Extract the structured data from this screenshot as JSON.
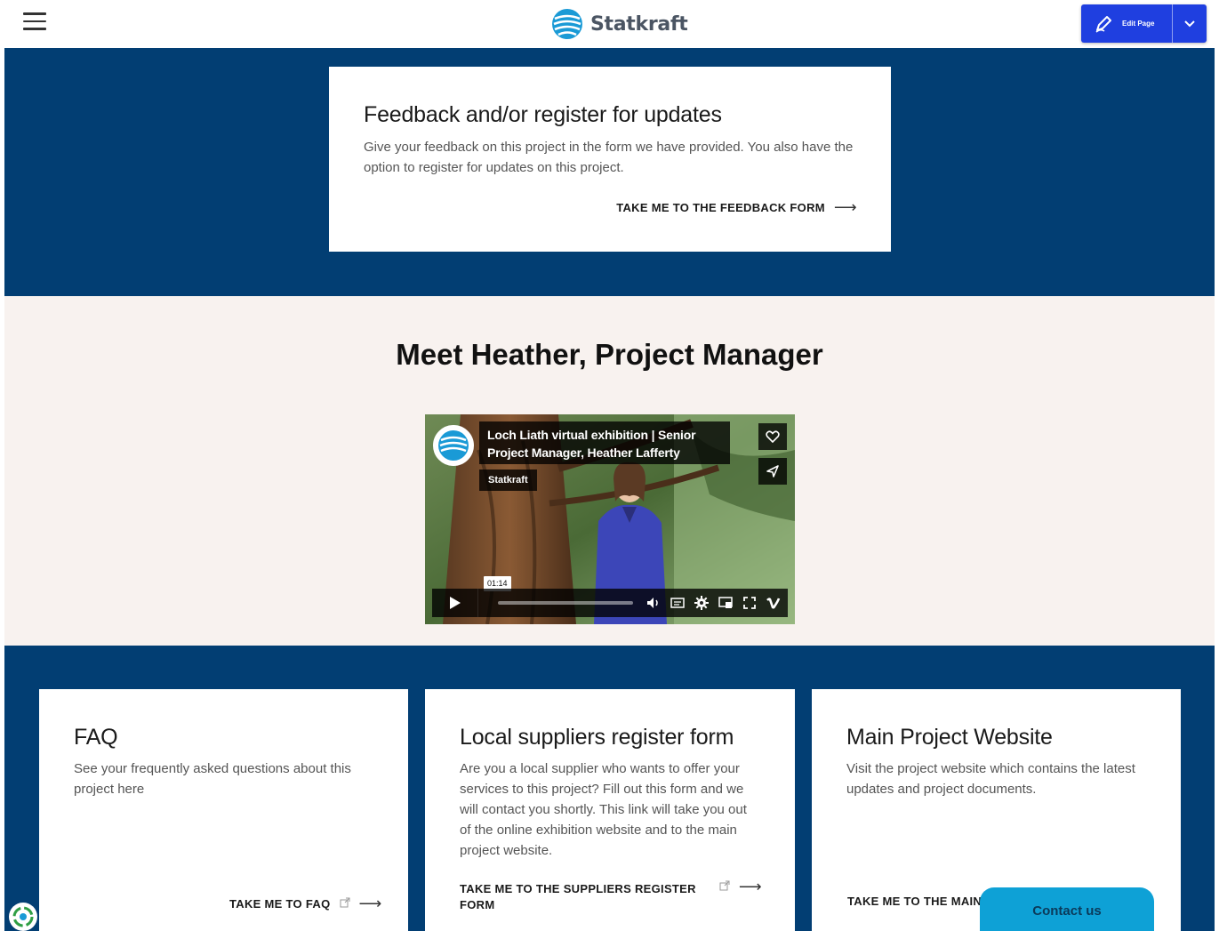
{
  "header": {
    "brand": "Statkraft",
    "edit_button_label": "Edit Page"
  },
  "feedback": {
    "title": "Feedback and/or register for updates",
    "body": "Give your feedback on this project in the form we have provided. You also have the option to register for updates on this project.",
    "cta": "TAKE ME TO THE FEEDBACK FORM"
  },
  "meet": {
    "heading": "Meet Heather, Project Manager"
  },
  "video": {
    "title": "Loch Liath virtual exhibition | Senior Project Manager, Heather Lafferty",
    "channel": "Statkraft",
    "time": "01:14",
    "progress": 0.0
  },
  "cards": [
    {
      "title": "FAQ",
      "body": "See your frequently asked questions about this project here",
      "cta": "TAKE ME TO FAQ"
    },
    {
      "title": "Local suppliers register form",
      "body": "Are you a local supplier who wants to offer your services to this project? Fill out this form and we will contact you shortly. This link will take you out of the online exhibition website and to the main project website.",
      "cta": "TAKE ME TO THE SUPPLIERS REGISTER FORM"
    },
    {
      "title": "Main Project Website",
      "body": "Visit the project website which contains the latest updates and project documents.",
      "cta": "TAKE ME TO THE MAIN"
    }
  ],
  "contact": {
    "label": "Contact us"
  },
  "colors": {
    "brand_blue": "#023e73",
    "beige": "#f8f2ef",
    "edit_blue": "#1f3fe0",
    "contact_cyan": "#0ea1d6"
  }
}
